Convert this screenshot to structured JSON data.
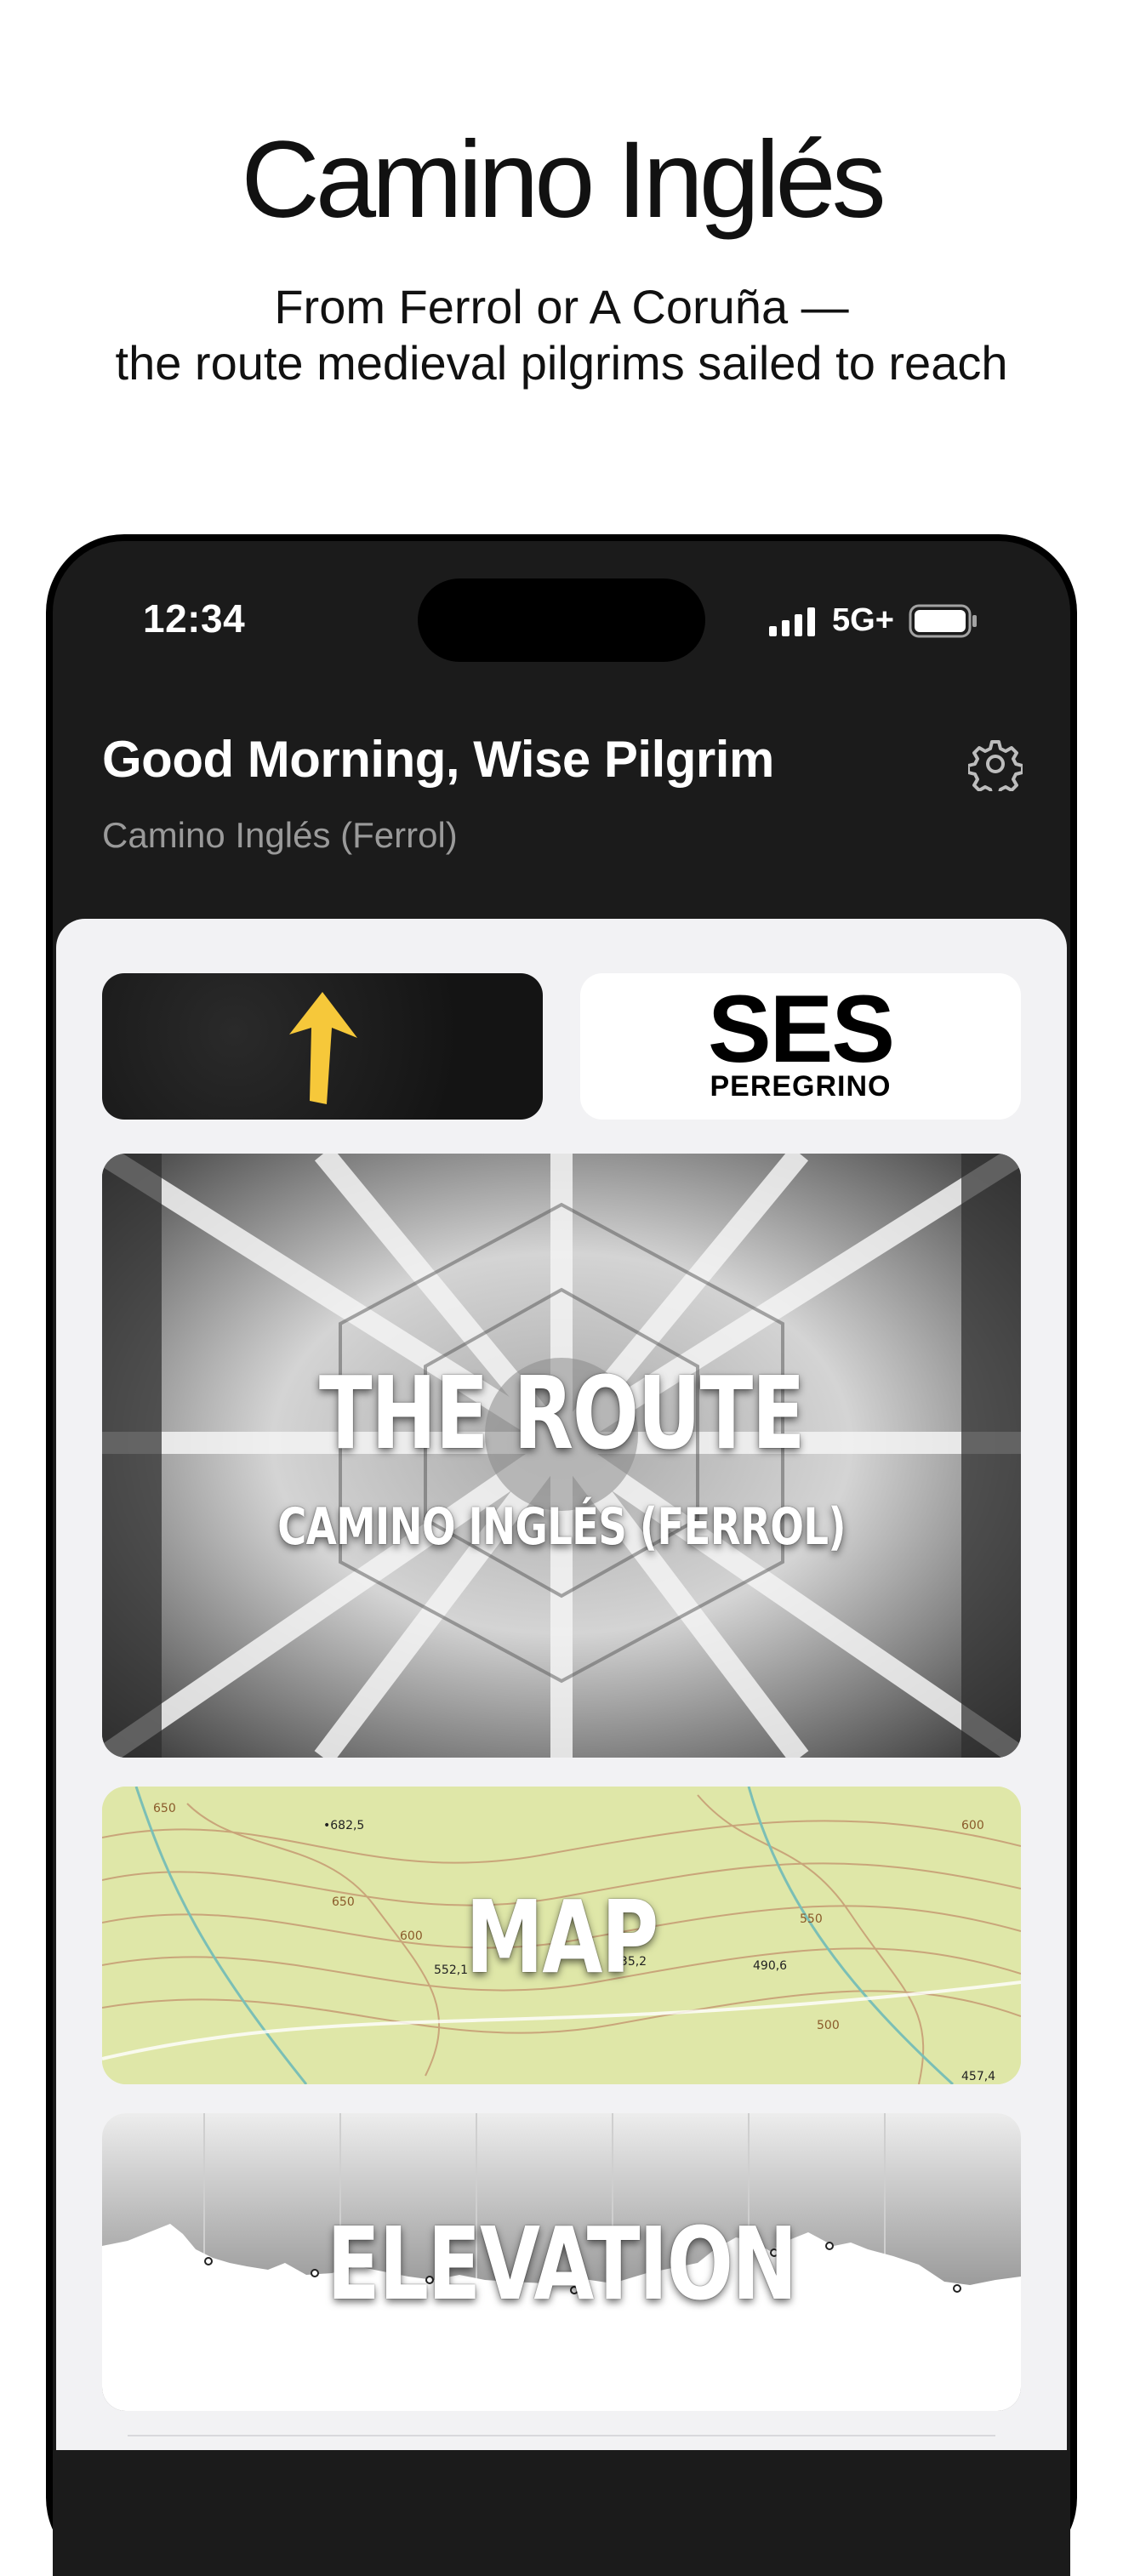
{
  "hero": {
    "title": "Camino Inglés",
    "subtitle_line1": "From Ferrol or A Coruña —",
    "subtitle_line2": "the route medieval pilgrims sailed to reach"
  },
  "status_bar": {
    "time": "12:34",
    "network": "5G+",
    "icons": [
      "signal-icon",
      "battery-icon"
    ]
  },
  "header": {
    "greeting": "Good Morning, Wise Pilgrim",
    "route": "Camino Inglés (Ferrol)",
    "settings_icon": "gear-icon"
  },
  "tiles": {
    "arrow": {
      "icon": "yellow-arrow-up-icon",
      "color": "#f6c83a"
    },
    "ses": {
      "big": "SES",
      "small": "PEREGRINO"
    }
  },
  "cards": {
    "route": {
      "title": "THE ROUTE",
      "subtitle": "CAMINO INGLÉS (FERROL)"
    },
    "map": {
      "title": "MAP",
      "labels": [
        "650",
        "•682,5",
        "650",
        "600",
        "552,1",
        "535,2",
        "490,6",
        "550",
        "600",
        "500",
        "457,4"
      ]
    },
    "elevation": {
      "title": "ELEVATION"
    }
  },
  "colors": {
    "header_bg": "#1b1b1b",
    "sheet_bg": "#f2f2f4",
    "accent_yellow": "#f6c83a",
    "map_green": "#dfe7a8"
  }
}
